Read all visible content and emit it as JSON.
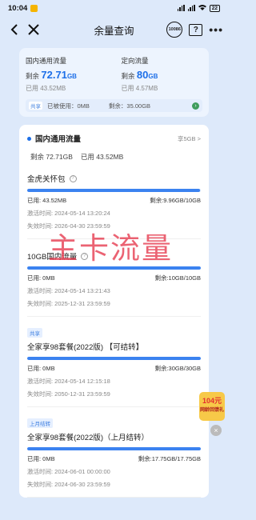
{
  "status_bar": {
    "time": "10:04",
    "battery": "22"
  },
  "nav": {
    "title": "余量查询",
    "service_icon_text": "10086",
    "help_icon_text": "?",
    "more_icon_text": "•••"
  },
  "summary": {
    "domestic": {
      "title": "国内通用流量",
      "remain_prefix": "剩余",
      "remain_value": "72.71",
      "remain_unit": "GB",
      "used": "已用 43.52MB"
    },
    "directed": {
      "title": "定向流量",
      "remain_prefix": "剩余",
      "remain_value": "80",
      "remain_unit": "GB",
      "used": "已用 4.57MB"
    },
    "share": {
      "tag": "共享",
      "used": "已被使用：0MB",
      "remain": "剩余：35.00GB"
    }
  },
  "section": {
    "title": "国内通用流量",
    "link": "享5GB >",
    "remain": "剩余 72.71GB",
    "used": "已用 43.52MB"
  },
  "packages": [
    {
      "tag": "",
      "name": "金虎关怀包",
      "used": "已用: 43.52MB",
      "remain": "剩余:9.96GB/10GB",
      "fill_percent": 99.6,
      "activated": "激活时间: 2024-05-14 13:20:24",
      "expires": "失效时间: 2026-04-30 23:59:59"
    },
    {
      "tag": "",
      "name": "10GB国内流量",
      "used": "已用: 0MB",
      "remain": "剩余:10GB/10GB",
      "fill_percent": 100,
      "activated": "激活时间: 2024-05-14 13:21:43",
      "expires": "失效时间: 2025-12-31 23:59:59"
    },
    {
      "tag": "共享",
      "name": "全家享98套餐(2022版) 【可结转】",
      "used": "已用: 0MB",
      "remain": "剩余:30GB/30GB",
      "fill_percent": 100,
      "activated": "激活时间: 2024-05-14 12:15:18",
      "expires": "失效时间: 2050-12-31 23:59:59"
    },
    {
      "tag": "上月结转",
      "name": "全家享98套餐(2022版)（上月结转）",
      "used": "已用: 0MB",
      "remain": "剩余:17.75GB/17.75GB",
      "fill_percent": 100,
      "activated": "激活时间: 2024-06-01 00:00:00",
      "expires": "失效时间: 2024-06-30 23:59:59"
    }
  ],
  "watermark": "主卡流量",
  "float_ad": {
    "amount": "104",
    "unit": "元",
    "text": "网龄回馈礼"
  },
  "colors": {
    "accent": "#1d6fe8",
    "bar": "#3b82f0",
    "watermark": "#e63c50"
  }
}
